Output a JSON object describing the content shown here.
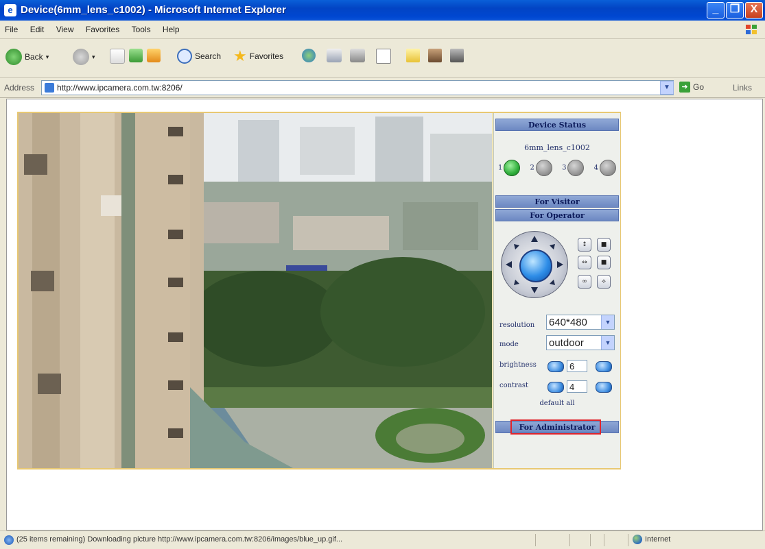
{
  "window": {
    "title": "Device(6mm_lens_c1002) - Microsoft Internet Explorer",
    "minimize": "_",
    "maximize": "❐",
    "close": "X"
  },
  "menu": [
    "File",
    "Edit",
    "View",
    "Favorites",
    "Tools",
    "Help"
  ],
  "toolbar": {
    "back": "Back",
    "search": "Search",
    "favorites": "Favorites"
  },
  "address": {
    "label": "Address",
    "url": "http://www.ipcamera.com.tw:8206/",
    "go": "Go",
    "links": "Links"
  },
  "panel": {
    "device_status_title": "Device Status",
    "device_name": "6mm_lens_c1002",
    "leds": [
      {
        "num": "1",
        "on": true
      },
      {
        "num": "2",
        "on": false
      },
      {
        "num": "3",
        "on": false
      },
      {
        "num": "4",
        "on": false
      }
    ],
    "visitor_title": "For Visitor",
    "operator_title": "For Operator",
    "resolution_label": "resolution",
    "resolution_value": "640*480",
    "mode_label": "mode",
    "mode_value": "outdoor",
    "brightness_label": "brightness",
    "brightness_value": "6",
    "contrast_label": "contrast",
    "contrast_value": "4",
    "default_all": "default all",
    "admin_title": "For Administrator"
  },
  "status": {
    "text": "(25 items remaining) Downloading picture http://www.ipcamera.com.tw:8206/images/blue_up.gif...",
    "zone": "Internet"
  },
  "colors": {
    "title_bar": "#0a52d0",
    "panel_header": "#7a93c8",
    "highlight": "#e0242c",
    "led_on": "#2fae3b"
  }
}
